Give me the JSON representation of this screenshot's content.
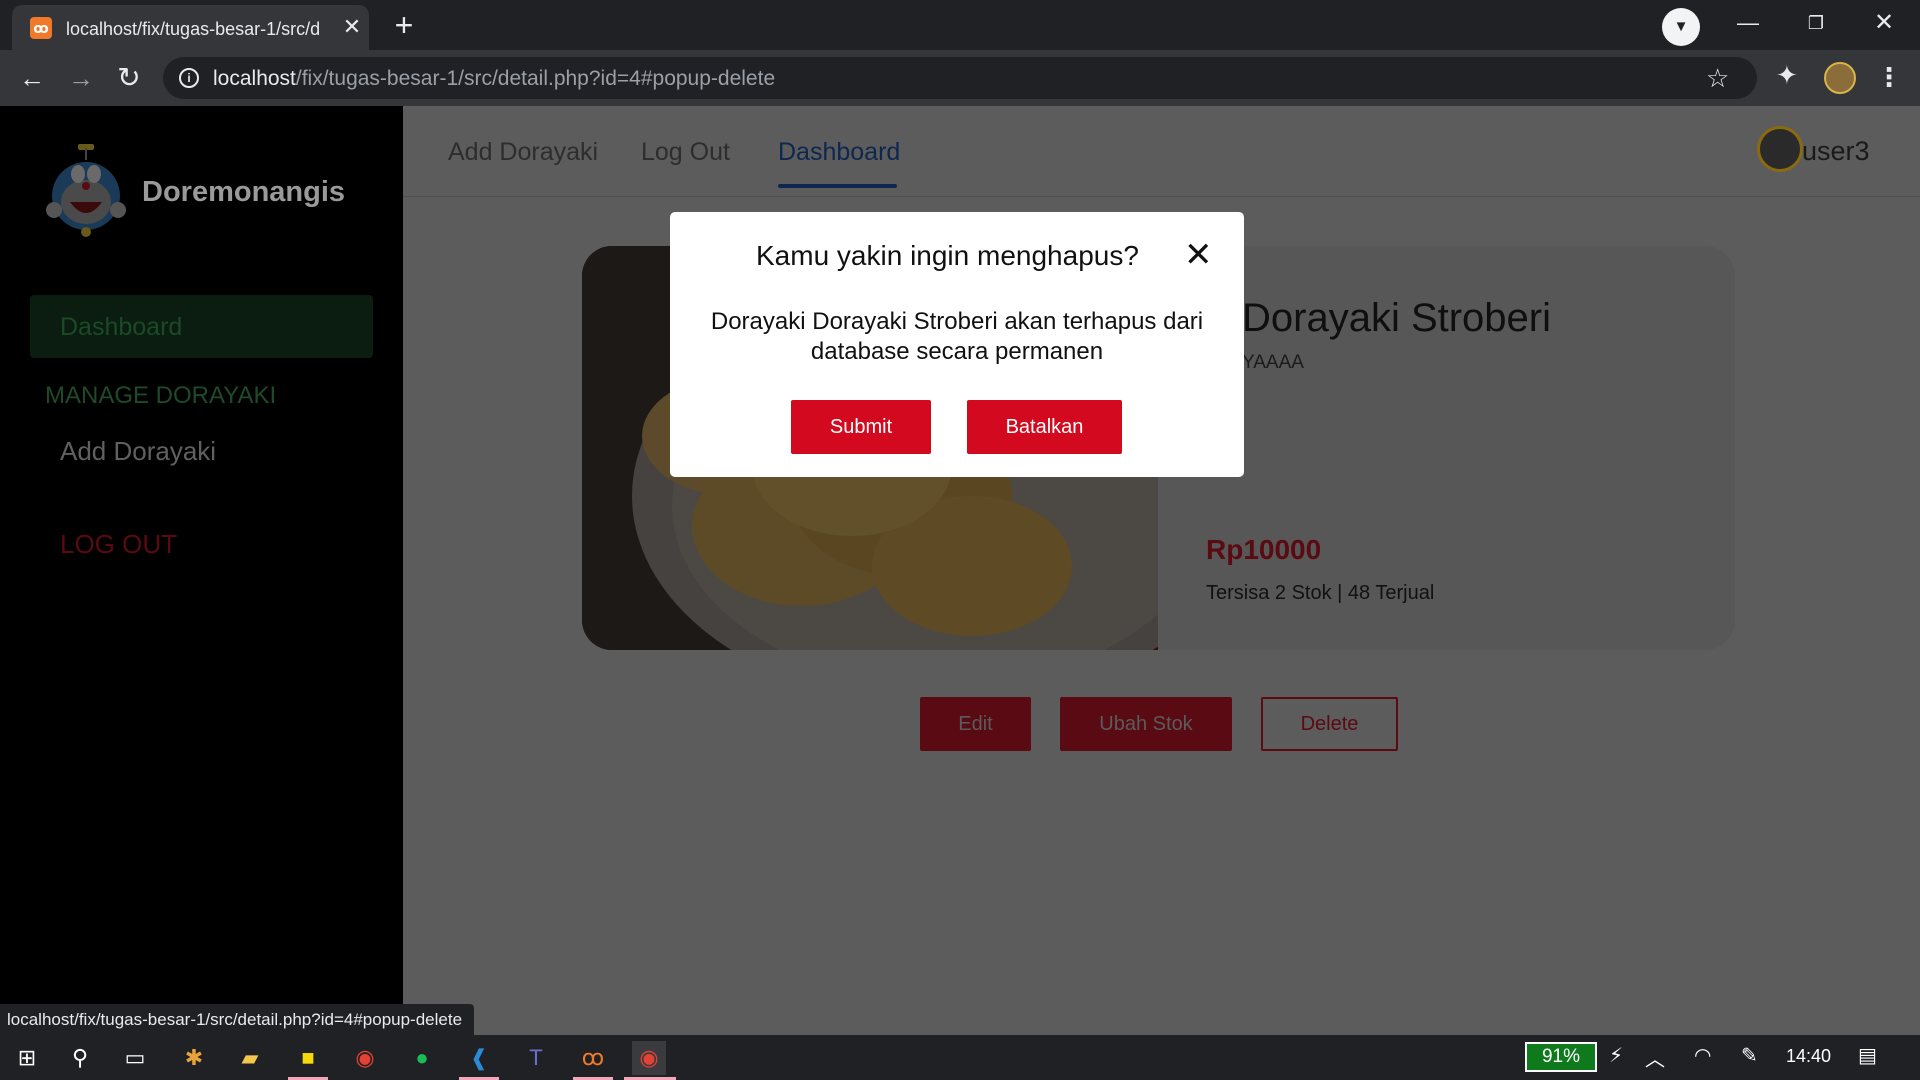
{
  "browser": {
    "tab_title": "localhost/fix/tugas-besar-1/src/d",
    "tab_favicon": "xampp-icon",
    "url_host": "localhost",
    "url_path": "/fix/tugas-besar-1/src/detail.php?id=4#popup-delete",
    "status_url": "localhost/fix/tugas-besar-1/src/detail.php?id=4#popup-delete"
  },
  "sidebar": {
    "brand": "Doremonangis",
    "dashboard": "Dashboard",
    "section": "MANAGE DORAYAKI",
    "add": "Add Dorayaki",
    "logout": "LOG OUT"
  },
  "topnav": {
    "add": "Add Dorayaki",
    "logout": "Log Out",
    "dashboard": "Dashboard",
    "username": "user3"
  },
  "product": {
    "name": "Dorayaki Stroberi",
    "description": "YAAAA",
    "price": "Rp10000",
    "stock": "Tersisa 2 Stok | 48 Terjual"
  },
  "actions": {
    "edit": "Edit",
    "stock": "Ubah Stok",
    "delete": "Delete"
  },
  "modal": {
    "title": "Kamu yakin ingin menghapus?",
    "close": "✕",
    "message": "Dorayaki Dorayaki Stroberi akan terhapus dari database secara permanen",
    "submit": "Submit",
    "cancel": "Batalkan"
  },
  "taskbar": {
    "battery": "91%",
    "time": "14:40"
  },
  "colors": {
    "accent_red": "#d3091f",
    "active_nav": "#0e2750",
    "battery_green": "#0f7a1c"
  }
}
